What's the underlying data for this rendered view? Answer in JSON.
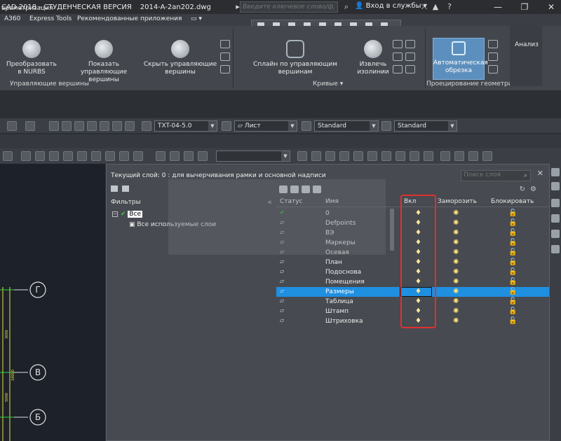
{
  "titlebar": {
    "title": "CAD 2018 - СТУДЕНЧЕСКАЯ ВЕРСИЯ",
    "filename": "2014-A-2an202.dwg",
    "search_placeholder": "Введите ключевое слово/фразу",
    "login": "Вход в службы",
    "minimize": "—",
    "restore": "❐",
    "close": "✕"
  },
  "menubar": {
    "tab_param": "араметризация",
    "items": [
      "A360",
      "Express Tools",
      "Рекомендованные приложения"
    ]
  },
  "ribbon": {
    "btn_nurbs": "Преобразовать в NURBS",
    "btn_show": "Показать управляющие вершины",
    "btn_hide": "Скрыть управляющие вершины",
    "panel_cv": "Управляющие вершины",
    "btn_spline": "Сплайн по управляющим вершинам",
    "btn_extract": "Извлечь изолинии",
    "panel_curves": "Кривые",
    "btn_auto": "Автоматическая обрезка",
    "panel_proj": "Проецирование геометрии",
    "tab_analysis": "Анализ"
  },
  "toolbar1": {
    "textstyle": "TXT-04-5.0",
    "layer": "Лист",
    "dimstyle": "Standard",
    "tablestyle": "Standard"
  },
  "layer_manager": {
    "header": "Текущий слой: 0 : для вычерчивания рамки и основной надписи",
    "search_placeholder": "Поиск слоя",
    "filters_header": "Фильтры",
    "tree_all": "Все",
    "tree_used": "Все используемые слои",
    "columns": {
      "status": "Статус",
      "name": "Имя",
      "on": "Вкл",
      "freeze": "Заморозить",
      "lock": "Блокировать"
    },
    "layers": [
      {
        "name": "0",
        "current": true,
        "selected": false
      },
      {
        "name": "Defpoints",
        "current": false,
        "selected": false
      },
      {
        "name": "ВЭ",
        "current": false,
        "selected": false
      },
      {
        "name": "Маркеры",
        "current": false,
        "selected": false
      },
      {
        "name": "Осевая",
        "current": false,
        "selected": false
      },
      {
        "name": "План",
        "current": false,
        "selected": false
      },
      {
        "name": "Подоснова",
        "current": false,
        "selected": false
      },
      {
        "name": "Помещения",
        "current": false,
        "selected": false
      },
      {
        "name": "Размеры",
        "current": false,
        "selected": true
      },
      {
        "name": "Таблица",
        "current": false,
        "selected": false
      },
      {
        "name": "Штамп",
        "current": false,
        "selected": false
      },
      {
        "name": "Штриховка",
        "current": false,
        "selected": false
      }
    ]
  },
  "drawing": {
    "axis_g": "Г",
    "axis_v": "В",
    "axis_b": "Б",
    "dim1": "3000",
    "dim2": "18000",
    "dim3": "5000"
  },
  "colors": {
    "highlight_box": "#e03030",
    "selected_row": "#1f8fe0"
  }
}
